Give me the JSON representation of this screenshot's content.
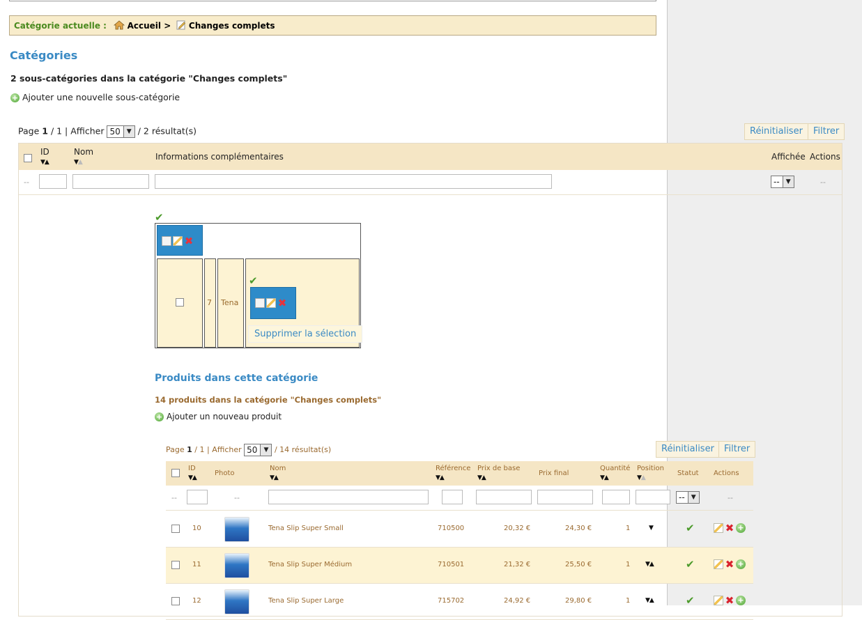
{
  "breadcrumb": {
    "label": "Catégorie actuelle :",
    "home": "Accueil >",
    "current": "Changes complets"
  },
  "categories_section": {
    "title": "Catégories",
    "count_text": "2 sous-catégories dans la catégorie \"Changes complets\"",
    "add_link": "Ajouter une nouvelle sous-catégorie"
  },
  "cat_pager": {
    "page_word": "Page",
    "page_current": "1",
    "page_total": "/ 1 | Afficher",
    "per_page": "50",
    "results": "/ 2 résultat(s)"
  },
  "cat_buttons": {
    "reset": "Réinitialiser",
    "filter": "Filtrer"
  },
  "cat_table": {
    "headers": {
      "id": "ID",
      "name": "Nom",
      "info": "Informations complémentaires",
      "shown": "Affichée",
      "actions": "Actions"
    },
    "filter_dash": "--",
    "shown_select": "--",
    "actions_dash": "--"
  },
  "nested_row": {
    "id": "7",
    "name": "Tena",
    "delete_selection": "Supprimer la sélection"
  },
  "products_section": {
    "title": "Produits dans cette catégorie",
    "count_text": "14 produits dans la catégorie \"Changes complets\"",
    "add_link": "Ajouter un nouveau produit"
  },
  "prod_pager": {
    "page_word": "Page",
    "page_current": "1",
    "page_total": "/ 1 | Afficher",
    "per_page": "50",
    "results": "/ 14 résultat(s)"
  },
  "prod_buttons": {
    "reset": "Réinitialiser",
    "filter": "Filtrer"
  },
  "prod_table": {
    "headers": {
      "id": "ID",
      "photo": "Photo",
      "name": "Nom",
      "reference": "Référence",
      "base_price": "Prix de base",
      "final_price": "Prix final",
      "quantity": "Quantité",
      "position": "Position",
      "status": "Statut",
      "actions": "Actions"
    },
    "filter_dash": "--",
    "status_select": "--",
    "rows": [
      {
        "id": "10",
        "name": "Tena Slip Super Small",
        "reference": "710500",
        "base_price": "20,32 €",
        "final_price": "24,30 €",
        "quantity": "1",
        "position_arrows": "▼"
      },
      {
        "id": "11",
        "name": "Tena Slip Super Médium",
        "reference": "710501",
        "base_price": "21,32 €",
        "final_price": "25,50 €",
        "quantity": "1",
        "position_arrows": "▼▲"
      },
      {
        "id": "12",
        "name": "Tena Slip Super Large",
        "reference": "715702",
        "base_price": "24,92 €",
        "final_price": "29,80 €",
        "quantity": "1",
        "position_arrows": "▼▲"
      }
    ]
  },
  "icons": {
    "home": "home-icon",
    "edit": "pencil-icon",
    "add": "plus-circle-icon",
    "check": "checkmark-icon",
    "delete": "delete-x-icon",
    "view": "document-icon"
  },
  "colors": {
    "accent_blue": "#3a8ac4",
    "header_beige": "#f5e6c5",
    "green": "#4b9a2a",
    "red": "#d9232e"
  }
}
